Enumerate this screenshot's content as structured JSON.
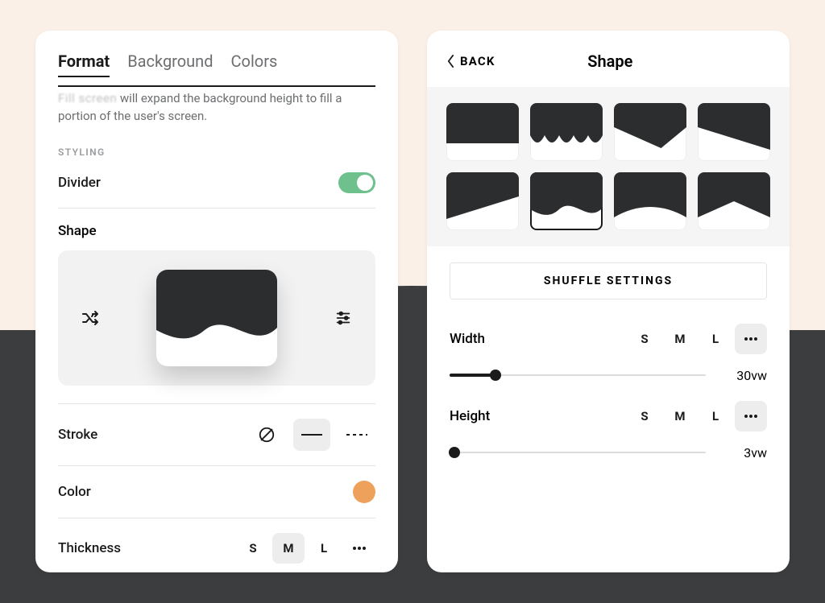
{
  "left": {
    "tabs": [
      "Format",
      "Background",
      "Colors"
    ],
    "active_tab_index": 0,
    "helper_blurred_prefix": "Fill screen",
    "helper_text": " will expand the background height to fill a portion of the user's screen.",
    "section_label": "STYLING",
    "divider": {
      "label": "Divider",
      "enabled": true
    },
    "shape": {
      "label": "Shape",
      "shuffle_icon": "shuffle-icon",
      "settings_icon": "sliders-icon",
      "selected_shape_id": "wave"
    },
    "stroke": {
      "label": "Stroke",
      "options": [
        {
          "id": "none",
          "icon": "no-icon"
        },
        {
          "id": "solid",
          "icon": "solid-line"
        },
        {
          "id": "dashed",
          "icon": "dashed-line"
        }
      ],
      "selected": "solid"
    },
    "color": {
      "label": "Color",
      "value": "#eea15a"
    },
    "thickness": {
      "label": "Thickness",
      "options": [
        "S",
        "M",
        "L"
      ],
      "has_custom": true,
      "selected": "M"
    }
  },
  "right": {
    "back_label": "BACK",
    "title": "Shape",
    "shapes": [
      "straight",
      "scallop-down",
      "angle-right",
      "slope-right",
      "slope-left",
      "wave",
      "arch",
      "pointed"
    ],
    "selected_shape": "wave",
    "shuffle_button": "SHUFFLE SETTINGS",
    "width": {
      "label": "Width",
      "sizes": [
        "S",
        "M",
        "L"
      ],
      "mode": "custom",
      "value_label": "30vw",
      "slider_percent": 18
    },
    "height": {
      "label": "Height",
      "sizes": [
        "S",
        "M",
        "L"
      ],
      "mode": "custom",
      "value_label": "3vw",
      "slider_percent": 2
    }
  }
}
